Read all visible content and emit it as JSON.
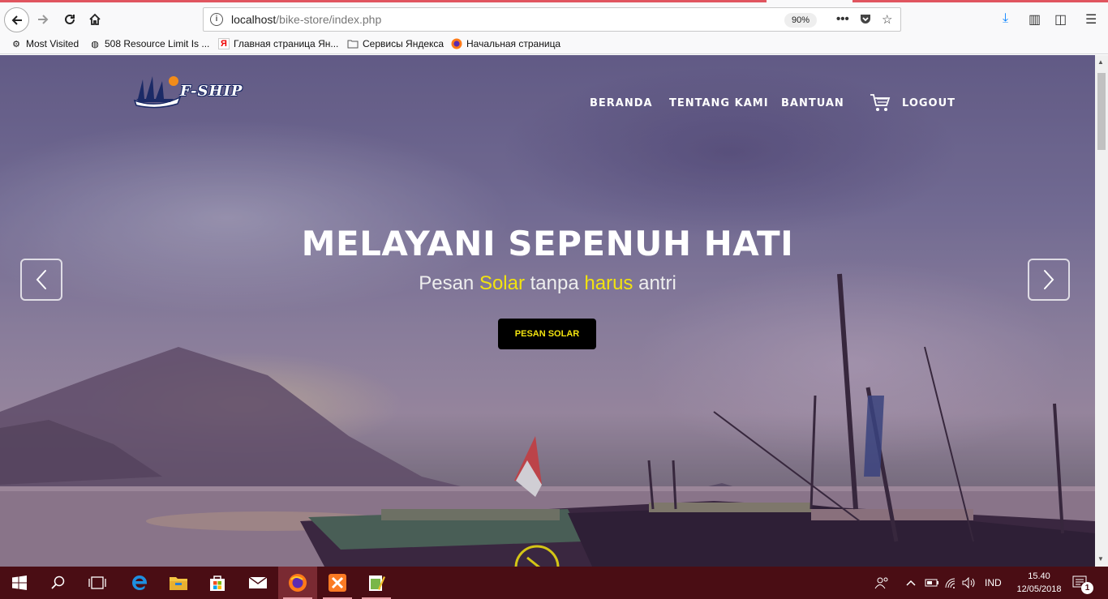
{
  "browser": {
    "url_host": "localhost",
    "url_path": "/bike-store/index.php",
    "zoom": "90%",
    "bookmarks": [
      {
        "label": "Most Visited",
        "icon": "gear-icon"
      },
      {
        "label": "508 Resource Limit Is ...",
        "icon": "globe-icon"
      },
      {
        "label": "Главная страница Ян...",
        "icon": "yandex-icon"
      },
      {
        "label": "Сервисы Яндекса",
        "icon": "folder-icon"
      },
      {
        "label": "Начальная страница",
        "icon": "firefox-icon"
      }
    ]
  },
  "site": {
    "logo_text": "F-SHIP",
    "nav": [
      "BERANDA",
      "TENTANG KAMI",
      "BANTUAN",
      "LOGOUT"
    ],
    "hero": {
      "title": "MELAYANI SEPENUH HATI",
      "subtitle_parts": [
        "Pesan ",
        "Solar",
        " tanpa ",
        "harus",
        " antri"
      ],
      "cta": "PESAN SOLAR"
    },
    "colors": {
      "accent": "#f2e30f",
      "taskbar": "#4a0d14"
    }
  },
  "taskbar": {
    "language": "IND",
    "time": "15.40",
    "date": "12/05/2018",
    "notifications": "1"
  }
}
